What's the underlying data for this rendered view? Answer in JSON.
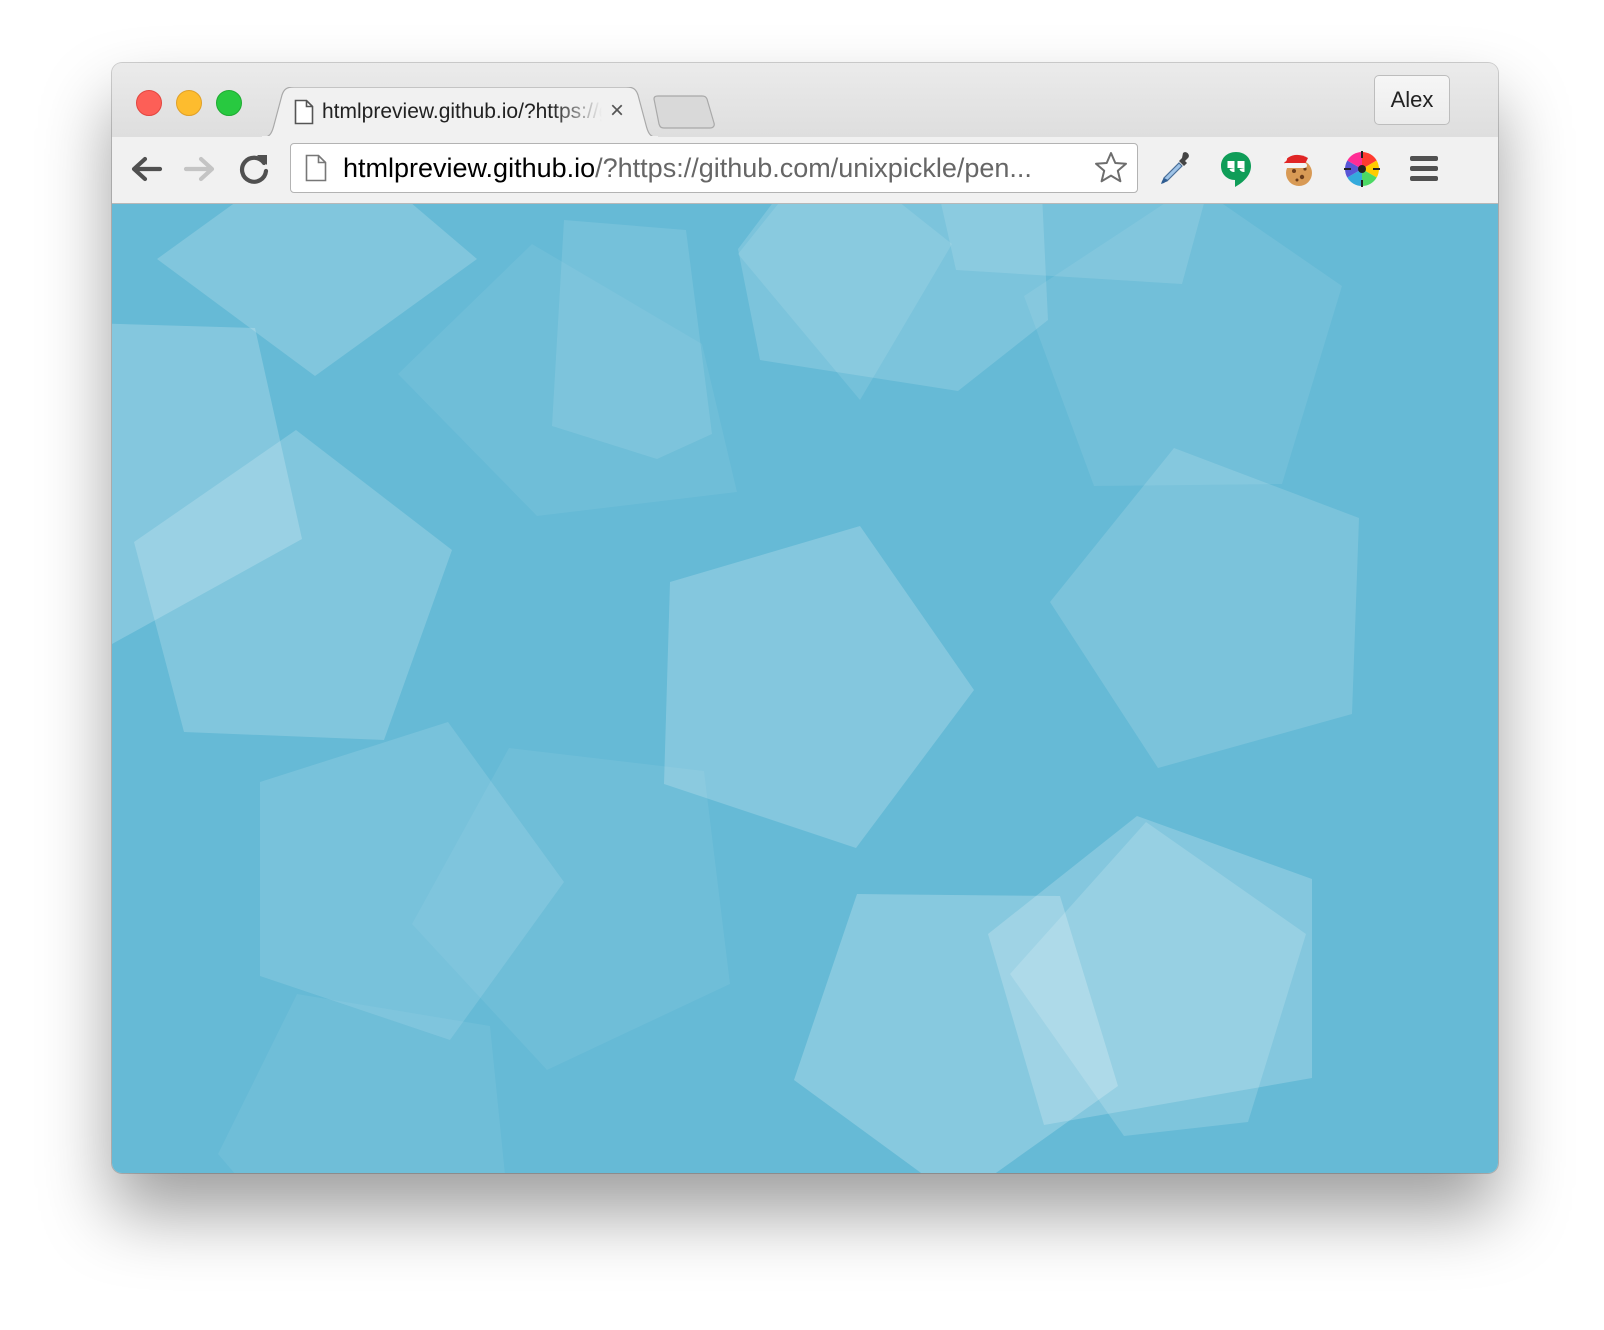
{
  "window": {
    "controls": [
      "close",
      "minimize",
      "zoom"
    ]
  },
  "tabs": [
    {
      "title": "htmlpreview.github.io/?https://github.com/unixpickle/pentagons",
      "favicon": "page-icon",
      "close_glyph": "×",
      "active": true
    }
  ],
  "new_tab_icon": "new-tab-icon",
  "profile": {
    "name": "Alex"
  },
  "toolbar": {
    "back_icon": "back-arrow-icon",
    "forward_icon": "forward-arrow-icon",
    "forward_enabled": false,
    "reload_icon": "reload-icon"
  },
  "omnibox": {
    "host": "htmlpreview.github.io",
    "path": "/?https://github.com/unixpickle/pen...",
    "page_icon": "page-icon",
    "star_icon": "bookmark-star-icon"
  },
  "extensions": [
    {
      "name": "eyedropper-extension-icon"
    },
    {
      "name": "hangouts-extension-icon"
    },
    {
      "name": "cookie-santa-hat-extension-icon"
    },
    {
      "name": "color-wheel-extension-icon"
    }
  ],
  "menu_icon": "hamburger-menu-icon",
  "colors": {
    "content_background": "#66bad6",
    "pentagon_fill": "#ffffff",
    "traffic_close": "#fd5f57",
    "traffic_minimize": "#fdbc2e",
    "traffic_zoom": "#28c940"
  }
}
